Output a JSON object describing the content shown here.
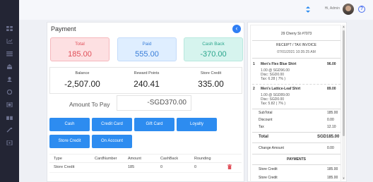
{
  "topbar": {
    "greeting": "Hi, Admin",
    "help_glyph": "?"
  },
  "sidebar": {
    "icons": [
      "grid-icon",
      "chart-icon",
      "list-icon",
      "store-icon",
      "user-icon",
      "box-icon",
      "database-icon",
      "gift-icon",
      "settings-icon",
      "tag-icon"
    ]
  },
  "payment": {
    "title": "Payment",
    "back_glyph": "‹",
    "total": {
      "label": "Total",
      "value": "185.00"
    },
    "paid": {
      "label": "Paid",
      "value": "555.00"
    },
    "cash_back": {
      "label": "Cash Back",
      "value": "-370.00"
    },
    "balance": {
      "label": "Balance",
      "value": "-2,507.00"
    },
    "reward_points": {
      "label": "Reward Points",
      "value": "240.41"
    },
    "store_credit": {
      "label": "Store Credit",
      "value": "335.00"
    },
    "amount_to_pay_label": "Amount To Pay",
    "amount_to_pay_value": "-SGD370.00",
    "buttons": [
      "Cash",
      "Credit Card",
      "Gift Card",
      "Loyalty",
      "Store Credit",
      "On Account"
    ],
    "table": {
      "headers": [
        "Type",
        "CardNumber",
        "Amount",
        "CashBack",
        "Rounding"
      ],
      "rows": [
        {
          "type": "Store Credit",
          "card": "",
          "amount": "185",
          "cashback": "0",
          "rounding": "0"
        }
      ]
    }
  },
  "receipt": {
    "address": "29 Cherry St #7073",
    "heading": "RECEIPT / TAX INVOICE",
    "datetime": "07/01/2021 10:35:25 AM",
    "items": [
      {
        "no": "1",
        "name": "Men's Flex Blue Shirt",
        "price": "96.00",
        "qty_line": "1.00 @ SGD96.00",
        "disc": "Disc: SGD0.00",
        "tax": "Tax: 6.28 ( 7% )"
      },
      {
        "no": "2",
        "name": "Men's Lattice-Leaf Shirt",
        "price": "89.00",
        "qty_line": "1.00 @ SGD89.00",
        "disc": "Disc: SGD0.00",
        "tax": "Tax: 5.82 ( 7% )"
      }
    ],
    "subtotal_label": "SubTotal",
    "subtotal": "185.00",
    "discount_label": "Discount",
    "discount": "0.00",
    "tax_label": "Tax",
    "tax": "12.10",
    "total_label": "Total",
    "total": "SGD185.00",
    "change_label": "Change Amount",
    "change": "0.00",
    "payments_heading": "PAYMENTS",
    "payments": [
      {
        "label": "Store Credit",
        "value": "185.00"
      },
      {
        "label": "Store Credit",
        "value": "185.00"
      }
    ]
  },
  "colors": {
    "accent": "#2d8cf0",
    "sidebar": "#232534",
    "total": "#e0505a",
    "paid": "#3a7ed8",
    "cash_back": "#2aa58c",
    "delete": "#e0505a"
  }
}
